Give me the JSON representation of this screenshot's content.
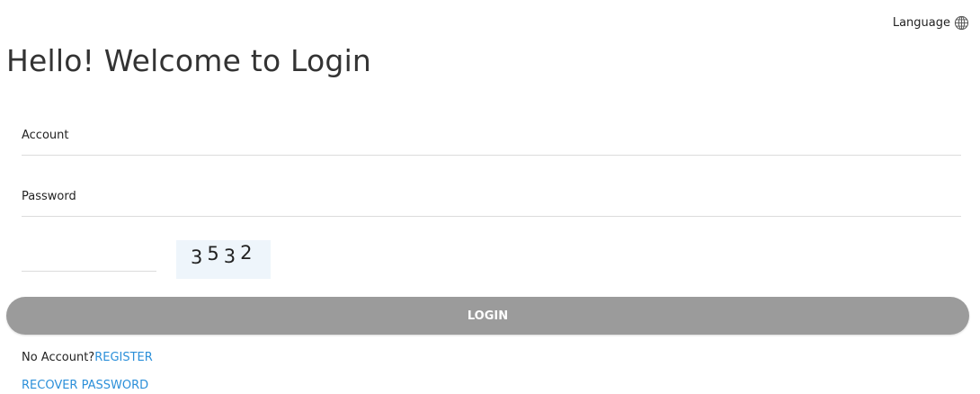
{
  "header": {
    "language_label": "Language",
    "language_icon": "globe-icon"
  },
  "title": "Hello! Welcome to Login",
  "form": {
    "account_placeholder": "Account",
    "password_placeholder": "Password",
    "captcha_placeholder": "",
    "captcha_code": "3532",
    "login_label": "LOGIN"
  },
  "footer": {
    "no_account_text": "No Account?",
    "register_label": "REGISTER",
    "recover_label": "RECOVER PASSWORD"
  },
  "colors": {
    "link": "#2b8fd9",
    "button_bg": "#9b9b9b",
    "captcha_bg": "#eef5fb"
  }
}
